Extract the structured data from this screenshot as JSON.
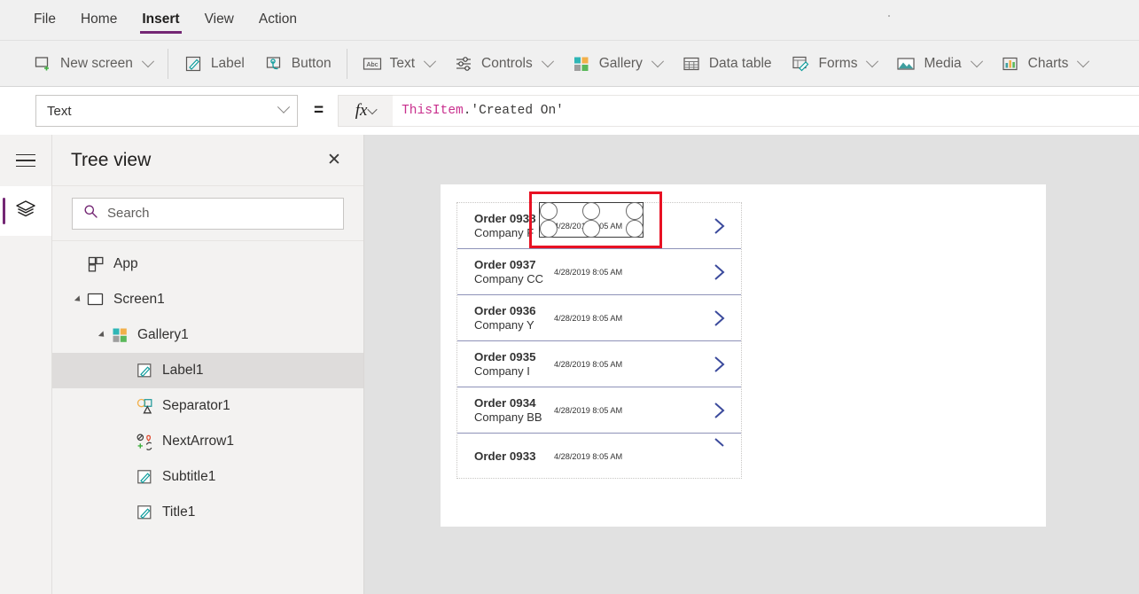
{
  "menu": {
    "items": [
      {
        "label": "File",
        "active": false
      },
      {
        "label": "Home",
        "active": false
      },
      {
        "label": "Insert",
        "active": true
      },
      {
        "label": "View",
        "active": false
      },
      {
        "label": "Action",
        "active": false
      }
    ]
  },
  "ribbon": {
    "groups": [
      {
        "buttons": [
          {
            "label": "New screen",
            "icon": "new-screen-icon",
            "caret": true
          }
        ]
      },
      {
        "buttons": [
          {
            "label": "Label",
            "icon": "label-icon",
            "caret": false
          },
          {
            "label": "Button",
            "icon": "button-icon",
            "caret": false
          }
        ]
      },
      {
        "buttons": [
          {
            "label": "Text",
            "icon": "text-abc-icon",
            "caret": true
          },
          {
            "label": "Controls",
            "icon": "controls-sliders-icon",
            "caret": true
          },
          {
            "label": "Gallery",
            "icon": "gallery-grid-icon",
            "caret": true
          },
          {
            "label": "Data table",
            "icon": "data-table-icon",
            "caret": false
          },
          {
            "label": "Forms",
            "icon": "forms-icon",
            "caret": true
          },
          {
            "label": "Media",
            "icon": "media-image-icon",
            "caret": true
          },
          {
            "label": "Charts",
            "icon": "charts-bar-icon",
            "caret": true
          }
        ]
      }
    ]
  },
  "formula_bar": {
    "property": "Text",
    "equals": "=",
    "fx_label": "fx",
    "formula_object": "ThisItem",
    "formula_rest": ".'Created On'"
  },
  "tree_panel": {
    "title": "Tree view",
    "close_label": "✕",
    "search_placeholder": "Search",
    "items": [
      {
        "label": "App",
        "icon": "app-icon",
        "indent": 0,
        "twisty": false,
        "selected": false
      },
      {
        "label": "Screen1",
        "icon": "screen-icon",
        "indent": 0,
        "twisty": true,
        "selected": false
      },
      {
        "label": "Gallery1",
        "icon": "gallery-grid-icon",
        "indent": 1,
        "twisty": true,
        "selected": false
      },
      {
        "label": "Label1",
        "icon": "label-icon",
        "indent": 2,
        "twisty": false,
        "selected": true
      },
      {
        "label": "Separator1",
        "icon": "shapes-icon",
        "indent": 2,
        "twisty": false,
        "selected": false
      },
      {
        "label": "NextArrow1",
        "icon": "icons-glyph-icon",
        "indent": 2,
        "twisty": false,
        "selected": false
      },
      {
        "label": "Subtitle1",
        "icon": "label-icon",
        "indent": 2,
        "twisty": false,
        "selected": false
      },
      {
        "label": "Title1",
        "icon": "label-icon",
        "indent": 2,
        "twisty": false,
        "selected": false
      }
    ]
  },
  "canvas": {
    "gallery": {
      "rows": [
        {
          "title": "Order 0938",
          "subtitle": "Company F",
          "date": "4/28/2019 8:05 AM",
          "chevron": "chevron-right-icon",
          "clipped": false
        },
        {
          "title": "Order 0937",
          "subtitle": "Company CC",
          "date": "4/28/2019 8:05 AM",
          "chevron": "chevron-right-icon",
          "clipped": false
        },
        {
          "title": "Order 0936",
          "subtitle": "Company Y",
          "date": "4/28/2019 8:05 AM",
          "chevron": "chevron-right-icon",
          "clipped": false
        },
        {
          "title": "Order 0935",
          "subtitle": "Company I",
          "date": "4/28/2019 8:05 AM",
          "chevron": "chevron-right-icon",
          "clipped": false
        },
        {
          "title": "Order 0934",
          "subtitle": "Company BB",
          "date": "4/28/2019 8:05 AM",
          "chevron": "chevron-right-icon",
          "clipped": false
        },
        {
          "title": "Order 0933",
          "subtitle": "",
          "date": "4/28/2019 8:05 AM",
          "chevron": "chevron-right-icon",
          "clipped": true
        }
      ]
    },
    "selection": {
      "control": "Label1",
      "border_color": "#e81123",
      "handle_count": 6
    }
  },
  "colors": {
    "accent_purple": "#742774",
    "selection_red": "#e81123",
    "formula_token": "#c9308e",
    "chevron_blue": "#3b4a9c",
    "canvas_bg": "#e1e1e1",
    "panel_bg": "#f3f2f1"
  }
}
